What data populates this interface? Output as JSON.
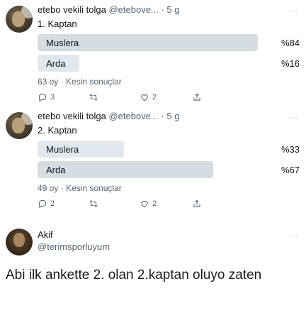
{
  "tweets": [
    {
      "name": "etebo vekili tolga",
      "handle": "@etebove...",
      "dot": "·",
      "time": "5 g",
      "more": "···",
      "question": "1. Kaptan",
      "options": [
        {
          "label": "Muslera",
          "percent": "%84",
          "fill": 0.84,
          "winner": true
        },
        {
          "label": "Arda",
          "percent": "%16",
          "fill": 0.16,
          "winner": false
        }
      ],
      "meta": "63 oy · Kesin sonuçlar",
      "actions": {
        "reply_count": "3",
        "retweet_count": "",
        "like_count": "2"
      }
    },
    {
      "name": "etebo vekili tolga",
      "handle": "@etebove...",
      "dot": "·",
      "time": "5 g",
      "more": "···",
      "question": "2. Kaptan",
      "options": [
        {
          "label": "Muslera",
          "percent": "%33",
          "fill": 0.33,
          "winner": false
        },
        {
          "label": "Arda",
          "percent": "%67",
          "fill": 0.67,
          "winner": true
        }
      ],
      "meta": "49 oy · Kesin sonuçlar",
      "actions": {
        "reply_count": "2",
        "retweet_count": "",
        "like_count": "2"
      }
    }
  ],
  "author": {
    "name": "Akif",
    "handle": "@terimsporluyum",
    "more": "···"
  },
  "caption": "Abi ilk ankette 2. olan 2.kaptan oluyo zaten"
}
